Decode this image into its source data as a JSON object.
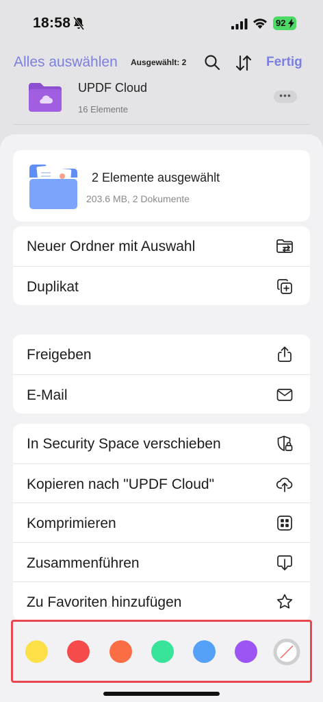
{
  "status_bar": {
    "time": "18:58",
    "battery": "92"
  },
  "nav": {
    "select_all": "Alles auswählen",
    "selected_count": "Ausgewählt: 2",
    "done": "Fertig"
  },
  "background_row": {
    "title": "UPDF Cloud",
    "subtitle": "16 Elemente",
    "more": "•••"
  },
  "summary": {
    "title": "2 Elemente ausgewählt",
    "subtitle": "203.6 MB, 2 Dokumente"
  },
  "groups": [
    {
      "items": [
        {
          "label": "Neuer Ordner mit Auswahl",
          "icon": "folder-move-icon"
        },
        {
          "label": "Duplikat",
          "icon": "duplicate-icon"
        }
      ]
    },
    {
      "items": [
        {
          "label": "Freigeben",
          "icon": "share-icon"
        },
        {
          "label": "E-Mail",
          "icon": "mail-icon"
        }
      ]
    },
    {
      "items": [
        {
          "label": "In Security Space verschieben",
          "icon": "shield-lock-icon"
        },
        {
          "label": "Kopieren nach \"UPDF Cloud\"",
          "icon": "cloud-upload-icon"
        },
        {
          "label": "Komprimieren",
          "icon": "compress-icon"
        },
        {
          "label": "Zusammenführen",
          "icon": "merge-icon"
        },
        {
          "label": "Zu Favoriten hinzufügen",
          "icon": "star-icon"
        }
      ]
    }
  ],
  "colors": {
    "accent": "#7b7fe0",
    "highlight_border": "#e8474f",
    "swatches": [
      {
        "name": "yellow",
        "hex": "#fde047"
      },
      {
        "name": "red",
        "hex": "#f54b4b"
      },
      {
        "name": "orange",
        "hex": "#fb6d45"
      },
      {
        "name": "green",
        "hex": "#38e49a"
      },
      {
        "name": "blue",
        "hex": "#55a0f9"
      },
      {
        "name": "purple",
        "hex": "#9c55f3"
      },
      {
        "name": "none",
        "hex": "#cfcfd2"
      }
    ]
  }
}
